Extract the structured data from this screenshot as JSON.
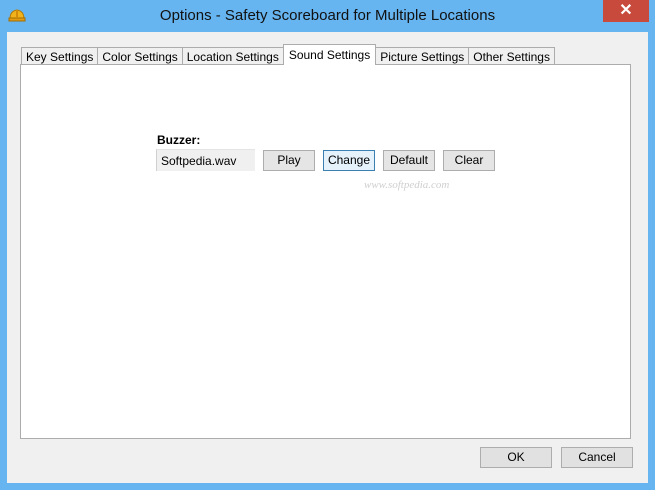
{
  "window": {
    "title": "Options - Safety Scoreboard for Multiple Locations",
    "close_glyph": "✕",
    "icon": "hardhat-icon"
  },
  "tabs": [
    {
      "label": "Key Settings",
      "active": false
    },
    {
      "label": "Color Settings",
      "active": false
    },
    {
      "label": "Location Settings",
      "active": false
    },
    {
      "label": "Sound Settings",
      "active": true
    },
    {
      "label": "Picture Settings",
      "active": false
    },
    {
      "label": "Other Settings",
      "active": false
    }
  ],
  "sound": {
    "buzzer_label": "Buzzer:",
    "buzzer_file": "Softpedia.wav",
    "play_label": "Play",
    "change_label": "Change",
    "default_label": "Default",
    "clear_label": "Clear"
  },
  "watermark": "www.softpedia.com",
  "footer": {
    "ok_label": "OK",
    "cancel_label": "Cancel"
  },
  "colors": {
    "titlebar": "#67b5f0",
    "close_button": "#c74a3c",
    "dialog_bg": "#f0f0f0",
    "focus_border": "#3c7fb1"
  }
}
